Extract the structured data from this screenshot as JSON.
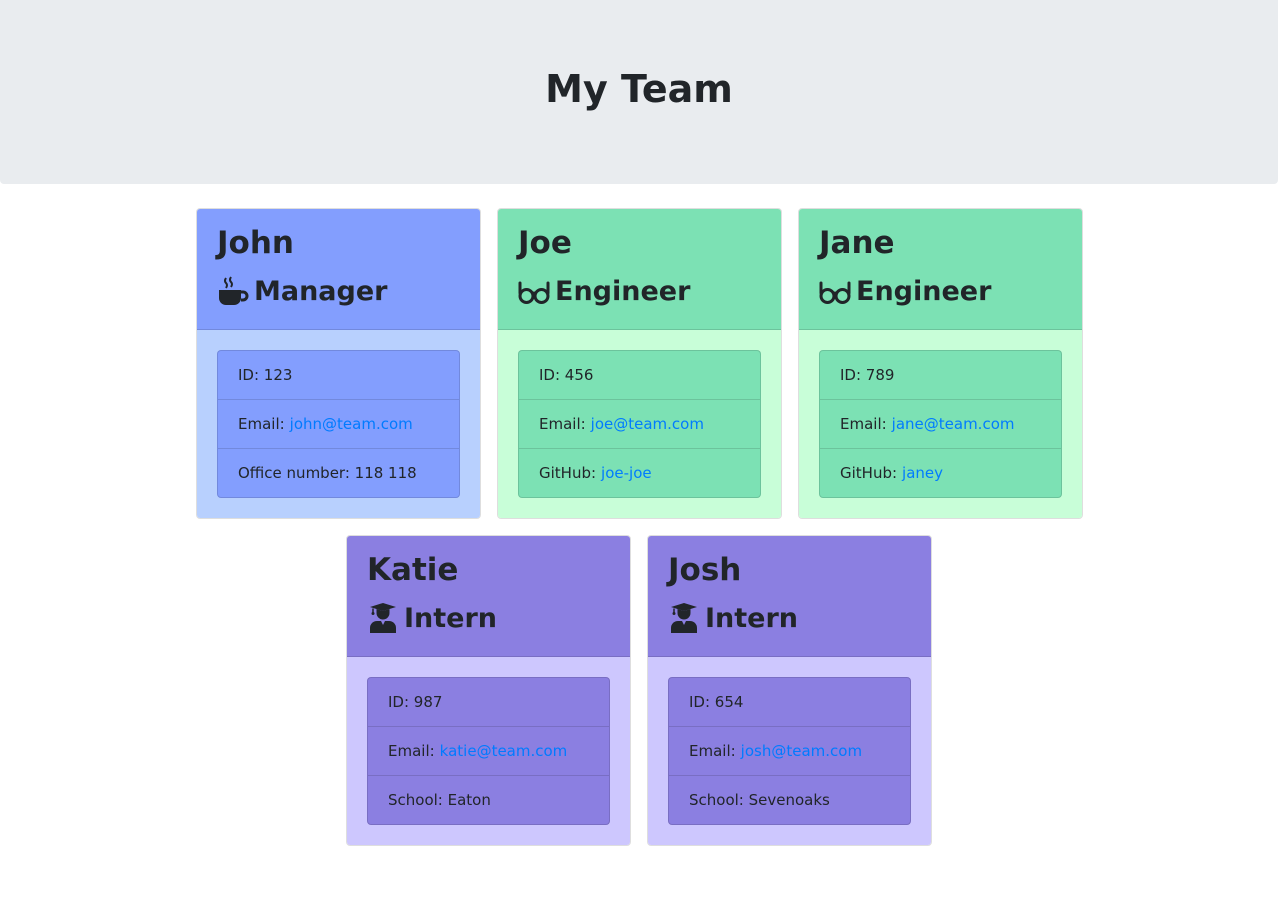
{
  "header": {
    "title": "My Team"
  },
  "colors": {
    "manager_header": "#839efe",
    "manager_body": "#b8d0fe",
    "engineer_header": "#7ce1b4",
    "engineer_body": "#c8fed8",
    "intern_header": "#8b7fe1",
    "intern_body": "#cdc7fe",
    "link": "#007bff"
  },
  "employees": [
    {
      "name": "John",
      "role": "Manager",
      "icon": "coffee-icon",
      "id_label": "ID: 123",
      "email_label": "Email:",
      "email": "john@team.com",
      "extra_label": "Office number: 118 118",
      "extra_link": ""
    },
    {
      "name": "Joe",
      "role": "Engineer",
      "icon": "glasses-icon",
      "id_label": "ID: 456",
      "email_label": "Email:",
      "email": "joe@team.com",
      "extra_label": "GitHub:",
      "extra_link": "joe-joe"
    },
    {
      "name": "Jane",
      "role": "Engineer",
      "icon": "glasses-icon",
      "id_label": "ID: 789",
      "email_label": "Email:",
      "email": "jane@team.com",
      "extra_label": "GitHub:",
      "extra_link": "janey"
    },
    {
      "name": "Katie",
      "role": "Intern",
      "icon": "graduate-icon",
      "id_label": "ID: 987",
      "email_label": "Email:",
      "email": "katie@team.com",
      "extra_label": "School: Eaton",
      "extra_link": ""
    },
    {
      "name": "Josh",
      "role": "Intern",
      "icon": "graduate-icon",
      "id_label": "ID: 654",
      "email_label": "Email:",
      "email": "josh@team.com",
      "extra_label": "School: Sevenoaks",
      "extra_link": ""
    }
  ]
}
